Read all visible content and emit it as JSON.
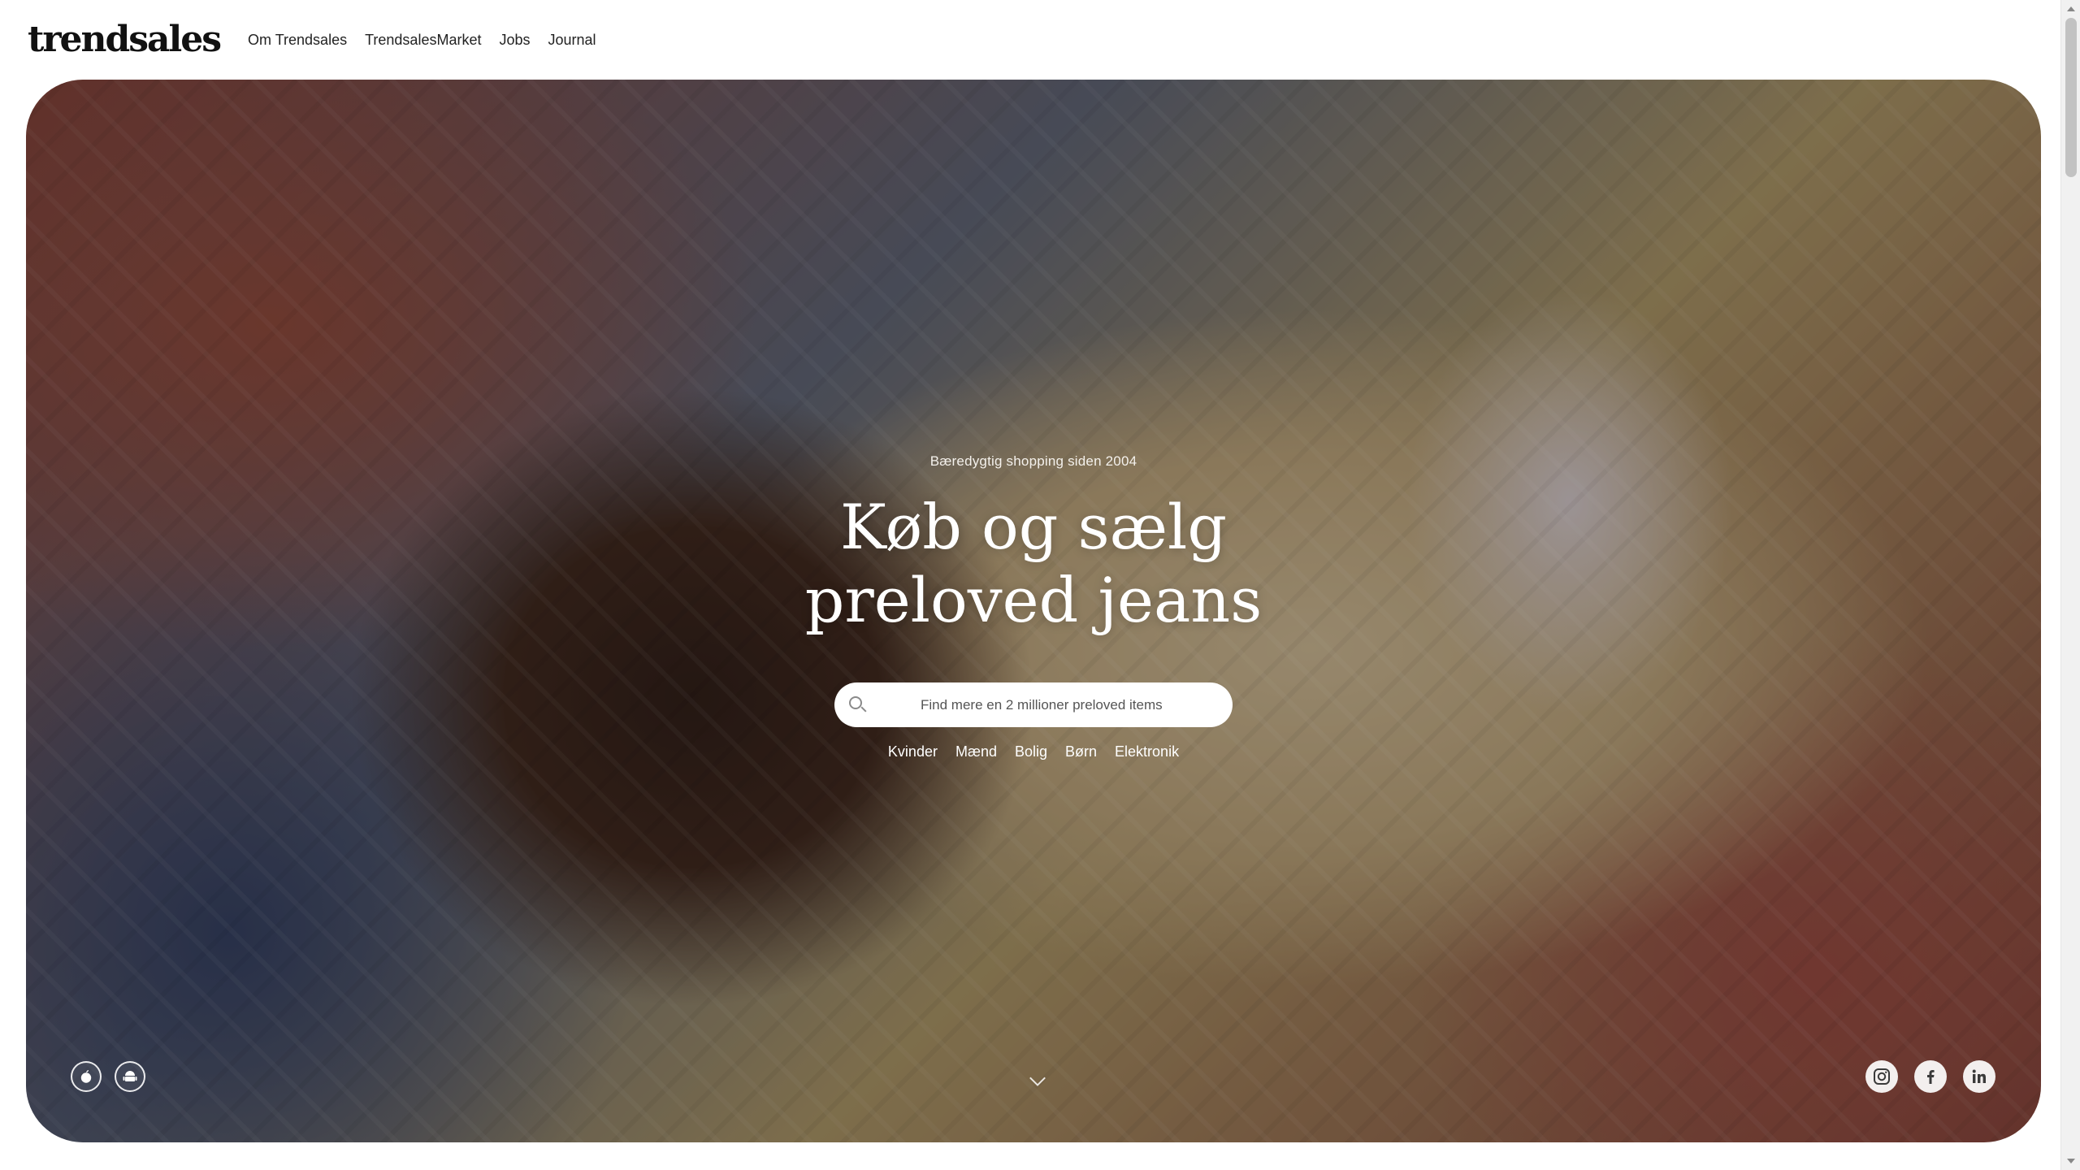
{
  "brand": {
    "logo_text": "trendsales"
  },
  "nav": {
    "items": [
      {
        "label": "Om Trendsales"
      },
      {
        "label": "TrendsalesMarket"
      },
      {
        "label": "Jobs"
      },
      {
        "label": "Journal"
      }
    ]
  },
  "hero": {
    "tagline": "Bæredygtig shopping siden 2004",
    "headline_line1": "Køb og sælg",
    "headline_line2": "preloved jeans",
    "search": {
      "placeholder": "Find mere en 2 millioner preloved items",
      "value": ""
    },
    "categories": [
      {
        "label": "Kvinder"
      },
      {
        "label": "Mænd"
      },
      {
        "label": "Bolig"
      },
      {
        "label": "Børn"
      },
      {
        "label": "Elektronik"
      }
    ]
  },
  "app_links": [
    {
      "icon": "apple-icon"
    },
    {
      "icon": "android-icon"
    }
  ],
  "social_links": [
    {
      "icon": "instagram-icon"
    },
    {
      "icon": "facebook-icon"
    },
    {
      "icon": "linkedin-icon"
    }
  ],
  "colors": {
    "text_dark": "#1a1a1a",
    "hero_text": "#ffffff",
    "search_bg": "#ffffff"
  }
}
